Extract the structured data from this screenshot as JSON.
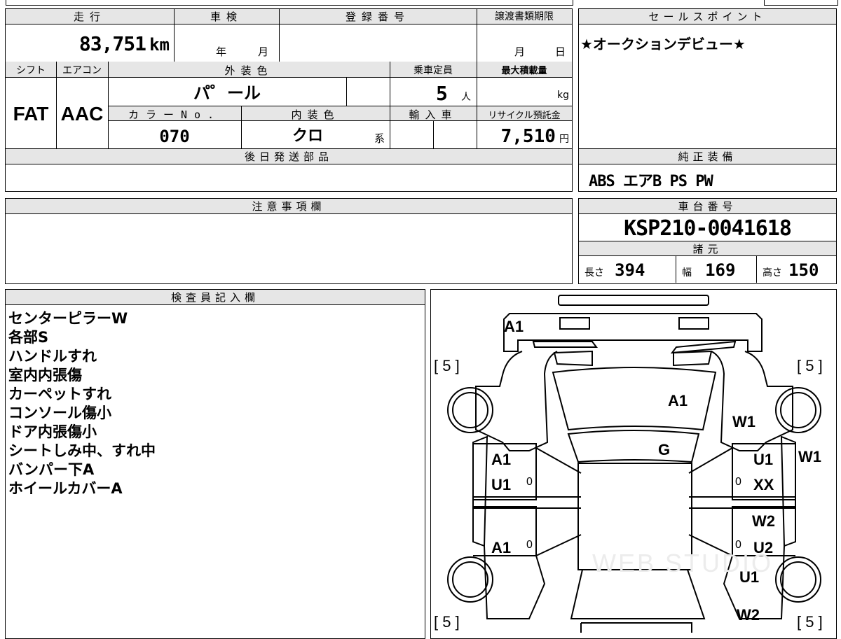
{
  "top": {
    "mileage": {
      "label": "走行",
      "value": "83,751",
      "unit": "km"
    },
    "shaken": {
      "label": "車検",
      "year": "年",
      "month": "月"
    },
    "registration": {
      "label": "登録番号"
    },
    "transfer_deadline": {
      "label": "譲渡書類期限",
      "month": "月",
      "day": "日"
    },
    "shift": {
      "label": "シフト",
      "value": "FAT"
    },
    "aircon": {
      "label": "エアコン",
      "value": "AAC"
    },
    "exterior_color": {
      "label": "外装色",
      "value": "パ゜ール"
    },
    "capacity": {
      "label": "乗車定員",
      "value": "5",
      "unit": "人"
    },
    "max_load": {
      "label": "最大積載量",
      "unit": "kg"
    },
    "color_no": {
      "label": "カラーNo.",
      "value": "070"
    },
    "interior_color": {
      "label": "内装色",
      "value": "クロ",
      "unit": "系"
    },
    "import": {
      "label": "輸入車"
    },
    "recycle": {
      "label": "リサイクル預託金",
      "value": "7,510",
      "unit": "円"
    },
    "later_parts": {
      "label": "後日発送部品"
    }
  },
  "sales_point": {
    "label": "セールスポイント",
    "text": "★オークションデビュー★"
  },
  "equipment": {
    "label": "純正装備",
    "text": "ABS エアB PS PW"
  },
  "notes_section": {
    "label": "注意事項欄"
  },
  "chassis": {
    "label": "車台番号",
    "value": "KSP210-0041618"
  },
  "specs": {
    "label": "諸元",
    "length_label": "長さ",
    "length": "394",
    "width_label": "幅",
    "width": "169",
    "height_label": "高さ",
    "height": "150"
  },
  "inspector": {
    "label": "検査員記入欄",
    "lines": [
      "センターピラーW",
      "各部S",
      "ハンドルすれ",
      "室内内張傷",
      "カーペットすれ",
      "コンソール傷小",
      "ドア内張傷小",
      "シートしみ中、すれ中",
      "バンパー下A",
      "ホイールカバーA"
    ]
  },
  "diagram": {
    "tires": [
      "[ 5 ]",
      "[ 5 ]",
      "[ 5 ]",
      "[ 5 ]"
    ],
    "marks": {
      "front_bumper": "A1",
      "hood": "A1",
      "windshield": "G",
      "front_right_fender": "W1",
      "right_side_panel": "W1",
      "front_left_door_1": "A1",
      "front_left_door_2": "U1",
      "front_right_door_1": "U1",
      "front_right_door_2": "XX",
      "rear_left_door": "A1",
      "rear_right_door_1": "W2",
      "rear_right_door_2": "U2",
      "rear_right_fender": "U1",
      "rear_right_quarter": "W2",
      "zero_1": "0",
      "zero_2": "0",
      "zero_3": "0",
      "zero_4": "0"
    },
    "watermark": "WEB STUDIO"
  }
}
